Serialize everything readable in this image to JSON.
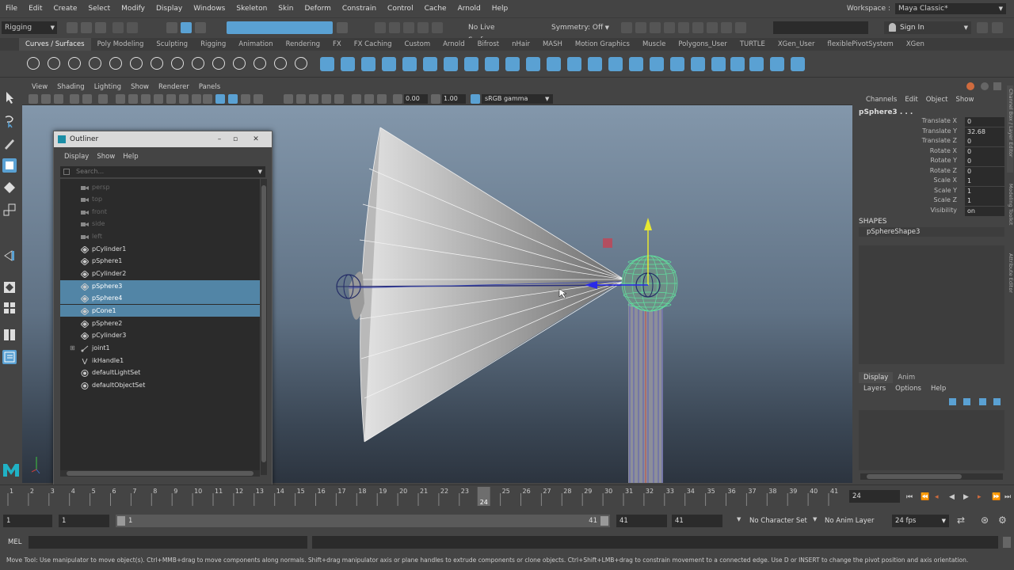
{
  "menubar": {
    "items": [
      "File",
      "Edit",
      "Create",
      "Select",
      "Modify",
      "Display",
      "Windows",
      "Skeleton",
      "Skin",
      "Deform",
      "Constrain",
      "Control",
      "Cache",
      "Arnold",
      "Help"
    ],
    "workspace_label": "Workspace :",
    "workspace_value": "Maya Classic*"
  },
  "statusline": {
    "menuset": "Rigging",
    "live_surface": "No Live Surface",
    "symmetry": "Symmetry: Off",
    "sign_in": "Sign In"
  },
  "shelf": {
    "tabs": [
      "Curves / Surfaces",
      "Poly Modeling",
      "Sculpting",
      "Rigging",
      "Animation",
      "Rendering",
      "FX",
      "FX Caching",
      "Custom",
      "Arnold",
      "Bifrost",
      "nHair",
      "MASH",
      "Motion Graphics",
      "Muscle",
      "Polygons_User",
      "TURTLE",
      "XGen_User",
      "flexiblePivotSystem",
      "XGen"
    ],
    "active_tab": "Curves / Surfaces"
  },
  "viewport": {
    "menus": [
      "View",
      "Shading",
      "Lighting",
      "Show",
      "Renderer",
      "Panels"
    ],
    "value_a": "0.00",
    "value_b": "1.00",
    "color_space": "sRGB gamma"
  },
  "outliner": {
    "title": "Outliner",
    "menus": [
      "Display",
      "Show",
      "Help"
    ],
    "search_placeholder": "Search...",
    "items": [
      {
        "name": "persp",
        "kind": "camera",
        "hidden": true,
        "selected": false
      },
      {
        "name": "top",
        "kind": "camera",
        "hidden": true,
        "selected": false
      },
      {
        "name": "front",
        "kind": "camera",
        "hidden": true,
        "selected": false
      },
      {
        "name": "side",
        "kind": "camera",
        "hidden": true,
        "selected": false
      },
      {
        "name": "left",
        "kind": "camera",
        "hidden": true,
        "selected": false
      },
      {
        "name": "pCylinder1",
        "kind": "mesh",
        "hidden": false,
        "selected": false
      },
      {
        "name": "pSphere1",
        "kind": "mesh",
        "hidden": false,
        "selected": false
      },
      {
        "name": "pCylinder2",
        "kind": "mesh",
        "hidden": false,
        "selected": false
      },
      {
        "name": "pSphere3",
        "kind": "mesh",
        "hidden": false,
        "selected": true
      },
      {
        "name": "pSphere4",
        "kind": "mesh",
        "hidden": false,
        "selected": true
      },
      {
        "name": "pCone1",
        "kind": "mesh",
        "hidden": false,
        "selected": true
      },
      {
        "name": "pSphere2",
        "kind": "mesh",
        "hidden": false,
        "selected": false
      },
      {
        "name": "pCylinder3",
        "kind": "mesh",
        "hidden": false,
        "selected": false
      },
      {
        "name": "joint1",
        "kind": "joint",
        "hidden": false,
        "selected": false
      },
      {
        "name": "ikHandle1",
        "kind": "ik",
        "hidden": false,
        "selected": false
      },
      {
        "name": "defaultLightSet",
        "kind": "set",
        "hidden": false,
        "selected": false
      },
      {
        "name": "defaultObjectSet",
        "kind": "set",
        "hidden": false,
        "selected": false
      }
    ]
  },
  "channelbox": {
    "menus": [
      "Channels",
      "Edit",
      "Object",
      "Show"
    ],
    "object": "pSphere3 . . .",
    "attributes": [
      {
        "label": "Translate X",
        "value": "0"
      },
      {
        "label": "Translate Y",
        "value": "32.68"
      },
      {
        "label": "Translate Z",
        "value": "0"
      },
      {
        "label": "Rotate X",
        "value": "0"
      },
      {
        "label": "Rotate Y",
        "value": "0"
      },
      {
        "label": "Rotate Z",
        "value": "0"
      },
      {
        "label": "Scale X",
        "value": "1"
      },
      {
        "label": "Scale Y",
        "value": "1"
      },
      {
        "label": "Scale Z",
        "value": "1"
      },
      {
        "label": "Visibility",
        "value": "on"
      }
    ],
    "shapes_header": "SHAPES",
    "shape": "pSphereShape3",
    "layer_tabs": [
      "Display",
      "Anim"
    ],
    "layer_menus": [
      "Layers",
      "Options",
      "Help"
    ]
  },
  "timeline": {
    "ticks": [
      "1",
      "2",
      "3",
      "4",
      "5",
      "6",
      "7",
      "8",
      "9",
      "10",
      "11",
      "12",
      "13",
      "14",
      "15",
      "16",
      "17",
      "18",
      "19",
      "20",
      "21",
      "22",
      "23",
      "24",
      "25",
      "26",
      "27",
      "28",
      "29",
      "30",
      "31",
      "32",
      "33",
      "34",
      "35",
      "36",
      "37",
      "38",
      "39",
      "40",
      "41"
    ],
    "current_frame": "24",
    "current_frame_field": "24"
  },
  "range": {
    "start": "1",
    "playback_start": "1",
    "slider_start": "1",
    "slider_end": "41",
    "playback_end": "41",
    "end": "41",
    "character_set": "No Character Set",
    "anim_layer": "No Anim Layer",
    "fps": "24 fps"
  },
  "mel": {
    "label": "MEL"
  },
  "help_line": "Move Tool: Use manipulator to move object(s). Ctrl+MMB+drag to move components along normals. Shift+drag manipulator axis or plane handles to extrude components or clone objects. Ctrl+Shift+LMB+drag to constrain movement to a connected edge. Use D or INSERT to change the pivot position and axis orientation.",
  "side_tabs": [
    "Channel Box / Layer Editor",
    "Modeling Toolkit",
    "Attribute Editor"
  ],
  "colors": {
    "selection": "#5285a6",
    "accent": "#5aa1d3"
  }
}
